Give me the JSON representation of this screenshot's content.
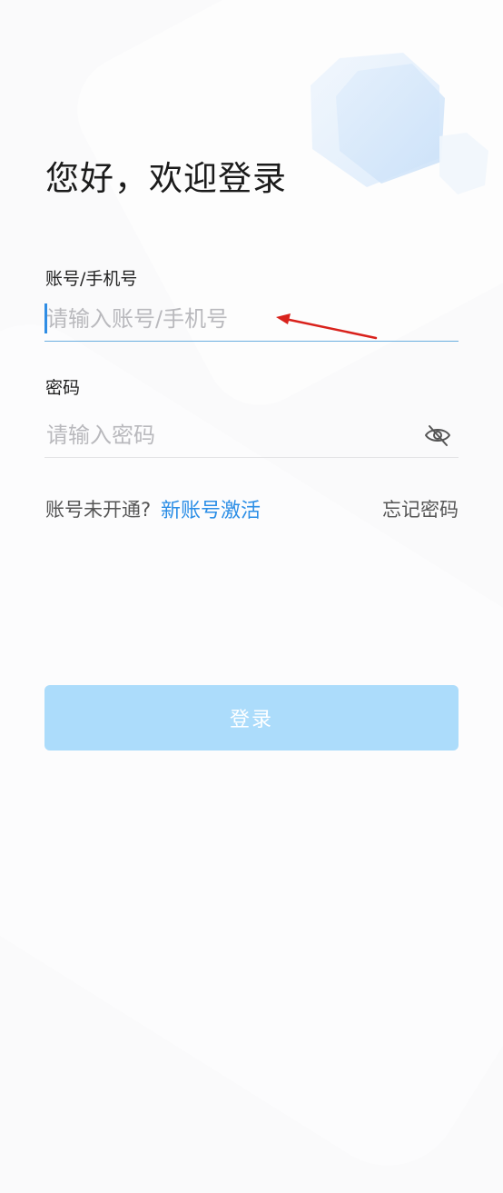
{
  "header": {
    "title": "您好，欢迎登录"
  },
  "account_field": {
    "label": "账号/手机号",
    "placeholder": "请输入账号/手机号",
    "value": ""
  },
  "password_field": {
    "label": "密码",
    "placeholder": "请输入密码",
    "value": "",
    "toggle_icon": "eye-off-icon"
  },
  "links": {
    "not_opened_text": "账号未开通?",
    "activate_label": "新账号激活",
    "forgot_label": "忘记密码"
  },
  "login_button": {
    "label": "登录"
  },
  "colors": {
    "accent": "#2b8ee6",
    "button_disabled": "#acdcfb",
    "focus_underline": "#6aaee0",
    "annotation_arrow": "#d9221c"
  }
}
